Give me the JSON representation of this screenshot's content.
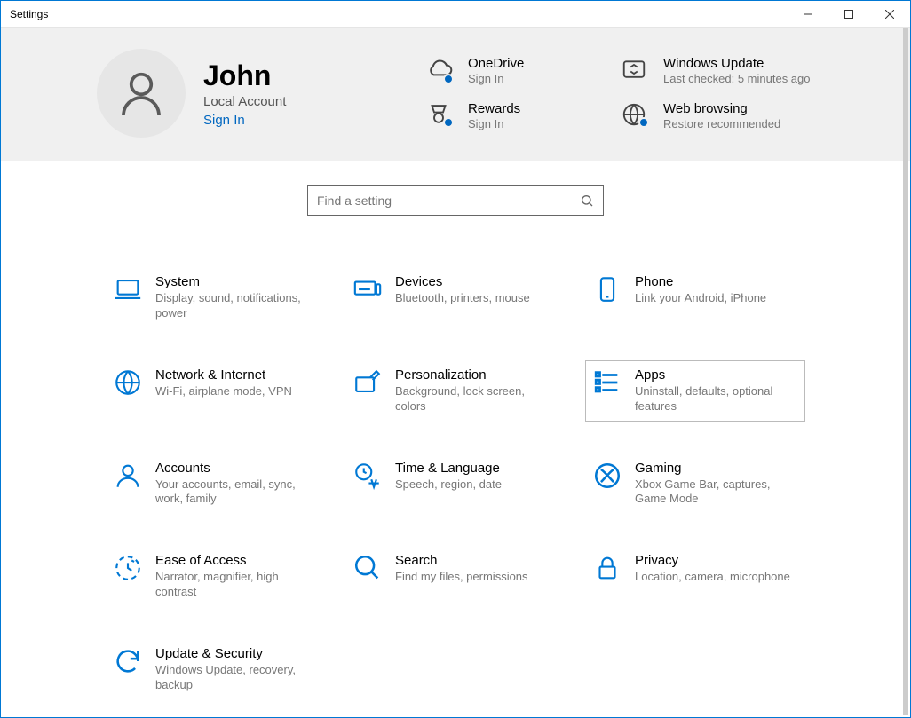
{
  "window": {
    "title": "Settings"
  },
  "user": {
    "name": "John",
    "type": "Local Account",
    "signin": "Sign In"
  },
  "tiles": {
    "onedrive": {
      "title": "OneDrive",
      "sub": "Sign In"
    },
    "rewards": {
      "title": "Rewards",
      "sub": "Sign In"
    },
    "update": {
      "title": "Windows Update",
      "sub": "Last checked: 5 minutes ago"
    },
    "web": {
      "title": "Web browsing",
      "sub": "Restore recommended"
    }
  },
  "search": {
    "placeholder": "Find a setting"
  },
  "categories": {
    "system": {
      "title": "System",
      "sub": "Display, sound, notifications, power"
    },
    "devices": {
      "title": "Devices",
      "sub": "Bluetooth, printers, mouse"
    },
    "phone": {
      "title": "Phone",
      "sub": "Link your Android, iPhone"
    },
    "network": {
      "title": "Network & Internet",
      "sub": "Wi-Fi, airplane mode, VPN"
    },
    "personal": {
      "title": "Personalization",
      "sub": "Background, lock screen, colors"
    },
    "apps": {
      "title": "Apps",
      "sub": "Uninstall, defaults, optional features"
    },
    "accounts": {
      "title": "Accounts",
      "sub": "Your accounts, email, sync, work, family"
    },
    "time": {
      "title": "Time & Language",
      "sub": "Speech, region, date"
    },
    "gaming": {
      "title": "Gaming",
      "sub": "Xbox Game Bar, captures, Game Mode"
    },
    "ease": {
      "title": "Ease of Access",
      "sub": "Narrator, magnifier, high contrast"
    },
    "searchc": {
      "title": "Search",
      "sub": "Find my files, permissions"
    },
    "privacy": {
      "title": "Privacy",
      "sub": "Location, camera, microphone"
    },
    "updatec": {
      "title": "Update & Security",
      "sub": "Windows Update, recovery, backup"
    }
  }
}
